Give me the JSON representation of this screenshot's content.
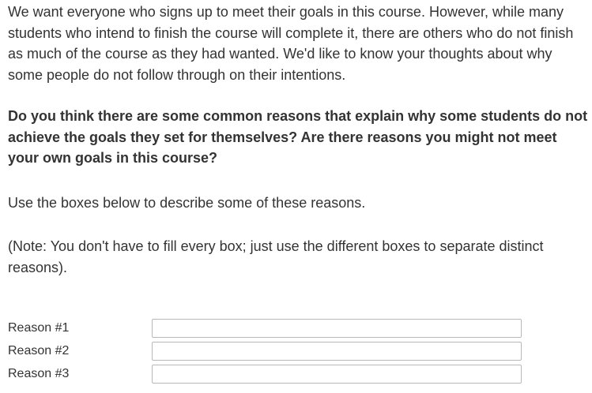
{
  "intro": "We want everyone who signs up to meet their goals in this course. However, while many students who intend to finish the course will complete it, there are others who do not finish as much of the course as they had wanted. We'd like to know your thoughts about why some people do not follow through on their intentions.",
  "question": "Do you think there are some common reasons that explain why some students do not achieve the goals they set for themselves? Are there reasons you might not meet your own goals in this course?",
  "instruction": "Use the boxes below to describe some of these reasons.",
  "note": "(Note: You don't have to fill every box; just use the different boxes to separate distinct reasons).",
  "reasons": [
    {
      "label": "Reason #1",
      "value": ""
    },
    {
      "label": "Reason #2",
      "value": ""
    },
    {
      "label": "Reason #3",
      "value": ""
    }
  ]
}
